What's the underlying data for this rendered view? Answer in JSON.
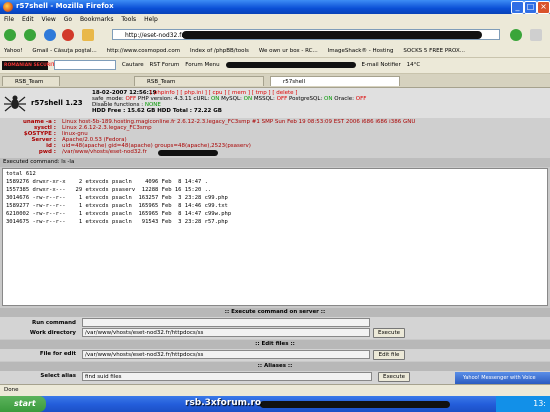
{
  "window": {
    "title": "r57shell - Mozilla Firefox"
  },
  "menu": [
    "File",
    "Edit",
    "View",
    "Go",
    "Bookmarks",
    "Tools",
    "Help"
  ],
  "nav": {
    "url": "http://eset-nod32.fr"
  },
  "bookmarks": [
    "Yahoo!",
    "Gmail - Căsuţa poştal...",
    "http://www.cosmopod.com",
    "Index of /phpBB/tools",
    "We own ur box - RC...",
    "ImageShack® - Hosting",
    "SOCKS 5 FREE PROX..."
  ],
  "toolbar2": {
    "items": [
      "Cautare",
      "RST Forum",
      "Forum Menu",
      "E-mail Notifier",
      "14°C"
    ],
    "brand": "ROMANIAN SECURITY TEAM"
  },
  "tabs": [
    {
      "label": "RSB_Team"
    },
    {
      "label": "RSB_Team"
    },
    {
      "label": "r57shell"
    }
  ],
  "shell": {
    "appname": "r57shell 1.23",
    "date": "18-02-2007 12:56:19",
    "links": "[ phpinfo ] [ php.ini ] [ cpu ] [ mem ] [ tmp ] [ delete ]",
    "safe_mode": "safe_mode:",
    "safe_mode_val": "OFF",
    "php_version": "PHP version: 4.3.11  cURL:",
    "curl_val": "ON",
    "mysql": "MySQL:",
    "mysql_val": "ON",
    "mssql": "MSSQL:",
    "mssql_val": "OFF",
    "pgsql": "PostgreSQL:",
    "pgsql_val": "ON",
    "oracle": "Oracle:",
    "oracle_val": "OFF",
    "disabled": "Disable functions :",
    "disabled_val": "NONE",
    "hdd": "HDD Free : 15.62 GB HDD Total : 72.22 GB"
  },
  "sysinfo": [
    {
      "label": "uname -a :",
      "value": "Linux host-5b-189.hosting.magiconline.fr 2.6.12-2.3.legacy_FC3smp #1 SMP Sun Feb 19 08:53:09 EST 2006 i686 i686 i386 GNU"
    },
    {
      "label": "sysctl :",
      "value": "Linux 2.6.12-2.3.legacy_FC3smp"
    },
    {
      "label": "$OSTYPE :",
      "value": "linux-gnu"
    },
    {
      "label": "Server :",
      "value": "Apache/2.0.53 (Fedora)"
    },
    {
      "label": "id :",
      "value": "uid=48(apache) gid=48(apache) groups=48(apache),2523(psaserv)"
    },
    {
      "label": "pwd :",
      "value": "/var/www/vhosts/eset-nod32.fr"
    }
  ],
  "executed": "Executed command: ls -la",
  "output": "total 612\n1589276 drwxr-xr-x    2 etxvcds psacln    4096 Feb  8 14:47 .\n1557385 drwxr-x---   29 etxvcds psaserv  12288 Feb 16 15:20 ..\n3014676 -rw-r--r--    1 etxvcds psacln  163257 Feb  3 23:28 c99.php\n1589277 -rw-r--r--    1 etxvcds psacln  165965 Feb  8 14:46 c99.txt\n6210002 -rw-r--r--    1 etxvcds psacln  165965 Feb  8 14:47 c99w.php\n3014675 -rw-r--r--    1 etxvcds psacln   91543 Feb  3 23:28 r57.php",
  "exec_section": {
    "header": ":: Execute command on server ::",
    "run_label": "Run command",
    "run_value": "",
    "workdir_label": "Work directory",
    "workdir_value": "/var/www/vhosts/eset-nod32.fr/httpdocs/ss",
    "execute_btn": "Execute"
  },
  "edit_section": {
    "header": ":: Edit files ::",
    "file_label": "File for edit",
    "file_value": "/var/www/vhosts/eset-nod32.fr/httpdocs/ss",
    "edit_btn": "Edit file"
  },
  "alias_section": {
    "header": ":: Aliases ::",
    "alias_label": "Select alias",
    "alias_value": "find suid files",
    "execute_btn": "Execute"
  },
  "status": "Done",
  "yahoo": "Yahoo! Messenger with Voice",
  "taskbar": {
    "start": "start",
    "watermark": "rsb.3xforum.ro",
    "clock": "13:"
  }
}
